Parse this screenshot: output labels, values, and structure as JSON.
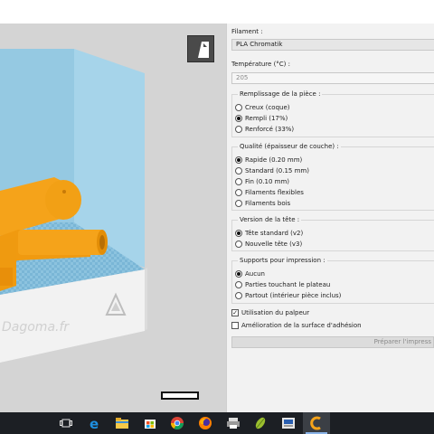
{
  "viewport": {
    "watermark": "Dagoma.fr",
    "colors": {
      "background": "#d4d4d4",
      "build_volume": "#9ecfe6",
      "bed": "#7fb8d6",
      "model": "#f5a31a",
      "base": "#f3f3f3"
    }
  },
  "view_icon": {
    "icon": "view-mode-icon"
  },
  "settings": {
    "filament_label": "Filament :",
    "filament_value": "PLA Chromatik",
    "temperature_label": "Température (°C) :",
    "temperature_value": "205",
    "infill": {
      "title": "Remplissage de la pièce :",
      "options": [
        "Creux (coque)",
        "Rempli (17%)",
        "Renforcé (33%)"
      ],
      "selected": "Rempli (17%)"
    },
    "quality": {
      "title": "Qualité (épaisseur de couche) :",
      "options": [
        "Rapide (0.20 mm)",
        "Standard (0.15 mm)",
        "Fin (0.10 mm)",
        "Filaments flexibles",
        "Filaments bois"
      ],
      "selected": "Rapide (0.20 mm)"
    },
    "head": {
      "title": "Version de la tête :",
      "options": [
        "Tête standard (v2)",
        "Nouvelle tête (v3)"
      ],
      "selected": "Tête standard (v2)"
    },
    "supports": {
      "title": "Supports pour impression :",
      "options": [
        "Aucun",
        "Parties touchant le plateau",
        "Partout (intérieur pièce inclus)"
      ],
      "selected": "Aucun"
    },
    "use_sensor": {
      "label": "Utilisation du palpeur",
      "checked": true
    },
    "adhesion": {
      "label": "Amélioration de la surface d'adhésion",
      "checked": false
    },
    "prepare_button": "Préparer l'impress"
  },
  "taskbar": {
    "items": [
      "task-view-icon",
      "edge-icon",
      "file-explorer-icon",
      "store-icon",
      "chrome-icon",
      "firefox-icon",
      "printer-app-icon",
      "leaf-app-icon",
      "media-app-icon",
      "cura-app-icon"
    ],
    "active": "cura-app-icon"
  }
}
